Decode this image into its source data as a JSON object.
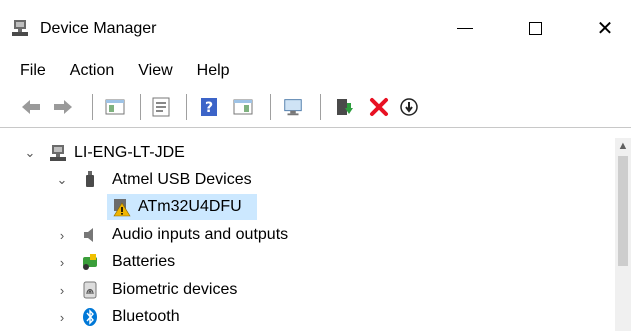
{
  "window": {
    "title": "Device Manager",
    "minimize_icon": "minimize-icon",
    "maximize_icon": "maximize-icon",
    "close_glyph": "✕"
  },
  "menu": [
    "File",
    "Action",
    "View",
    "Help"
  ],
  "toolbar": {
    "buttons": [
      "back-arrow-icon",
      "forward-arrow-icon",
      "properties-icon",
      "console-tree-icon",
      "help-icon",
      "driver-details-icon",
      "scan-hardware-icon",
      "update-driver-icon",
      "uninstall-device-icon",
      "disable-device-icon"
    ]
  },
  "tree": {
    "root": {
      "label": "LI-ENG-LT-JDE",
      "expanded": true
    },
    "items": [
      {
        "label": "Atmel USB Devices",
        "expanded": true,
        "icon": "usb-plug-icon"
      },
      {
        "label": "ATm32U4DFU",
        "warning": true,
        "selected": true,
        "icon": "warning-device-icon"
      },
      {
        "label": "Audio inputs and outputs",
        "expanded": false,
        "icon": "speaker-icon"
      },
      {
        "label": "Batteries",
        "expanded": false,
        "icon": "battery-icon"
      },
      {
        "label": "Biometric devices",
        "expanded": false,
        "icon": "fingerprint-icon"
      },
      {
        "label": "Bluetooth",
        "expanded": false,
        "icon": "bluetooth-icon"
      }
    ]
  },
  "colors": {
    "selection": "#cce8ff",
    "bluetooth": "#0078d7",
    "uninstall_red": "#e81123",
    "warning": "#f0b400"
  }
}
